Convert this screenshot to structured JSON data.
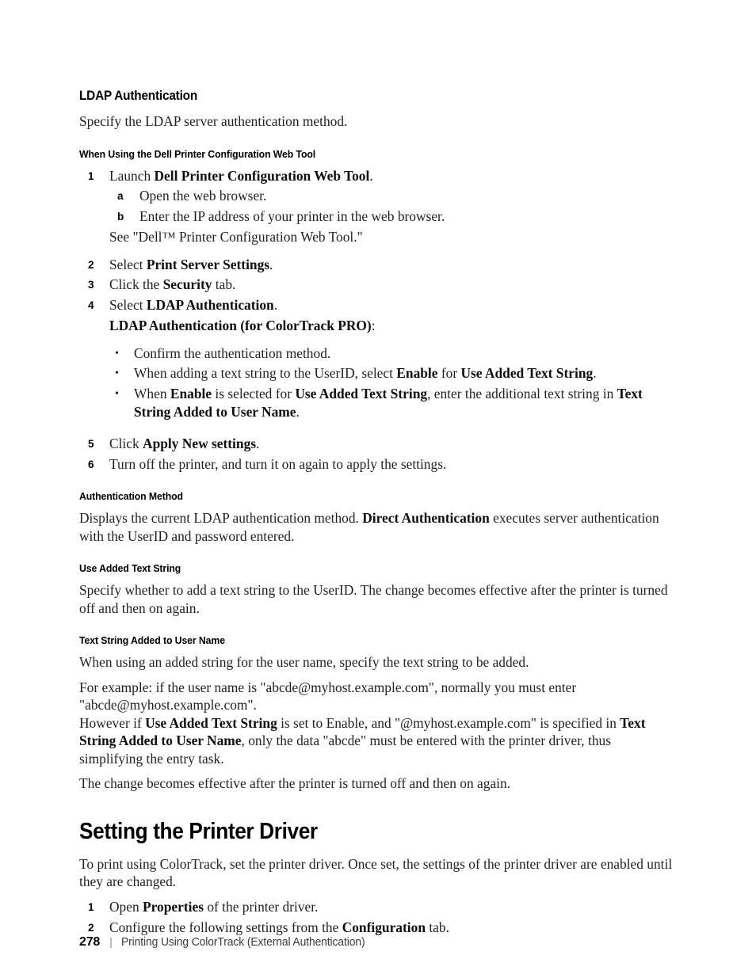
{
  "section": {
    "heading": "LDAP Authentication",
    "intro": "Specify the LDAP server authentication method."
  },
  "web_tool": {
    "heading": "When Using the Dell Printer Configuration Web Tool",
    "step1": {
      "num": "1",
      "text_before": "Launch ",
      "bold": "Dell Printer Configuration Web Tool",
      "text_after": "."
    },
    "substeps": [
      {
        "alpha": "a",
        "text": "Open the web browser."
      },
      {
        "alpha": "b",
        "text": "Enter the IP address of your printer in the web browser."
      }
    ],
    "see_note": "See \"Dell™ Printer Configuration Web Tool.\"",
    "step2": {
      "num": "2",
      "text_before": "Select ",
      "bold": "Print Server Settings",
      "text_after": "."
    },
    "step3": {
      "num": "3",
      "text_before": "Click the ",
      "bold": "Security",
      "text_after": " tab."
    },
    "step4": {
      "num": "4",
      "text_before": "Select ",
      "bold": "LDAP Authentication",
      "text_after": "."
    },
    "step4_subtitle_bold": "LDAP Authentication (for ColorTrack PRO)",
    "step4_subtitle_after": ":",
    "bullets": [
      {
        "parts": [
          {
            "t": "Confirm the authentication method.",
            "b": false
          }
        ]
      },
      {
        "parts": [
          {
            "t": "When adding a text string to the UserID, select ",
            "b": false
          },
          {
            "t": "Enable",
            "b": true
          },
          {
            "t": " for ",
            "b": false
          },
          {
            "t": "Use Added Text String",
            "b": true
          },
          {
            "t": ".",
            "b": false
          }
        ]
      },
      {
        "parts": [
          {
            "t": "When ",
            "b": false
          },
          {
            "t": "Enable",
            "b": true
          },
          {
            "t": " is selected for ",
            "b": false
          },
          {
            "t": "Use Added Text String",
            "b": true
          },
          {
            "t": ", enter the additional text string in ",
            "b": false
          },
          {
            "t": "Text String Added to User Name",
            "b": true
          },
          {
            "t": ".",
            "b": false
          }
        ]
      }
    ],
    "step5": {
      "num": "5",
      "text_before": "Click ",
      "bold": "Apply New settings",
      "text_after": "."
    },
    "step6": {
      "num": "6",
      "text_before": "Turn off the printer, and turn it on again to apply the settings.",
      "bold": "",
      "text_after": ""
    }
  },
  "auth_method": {
    "heading": "Authentication Method",
    "parts": [
      {
        "t": "Displays the current LDAP authentication method. ",
        "b": false
      },
      {
        "t": "Direct Authentication",
        "b": true
      },
      {
        "t": " executes server authentication with the UserID and password entered.",
        "b": false
      }
    ]
  },
  "use_added_text_string": {
    "heading": "Use Added Text String",
    "body": "Specify whether to add a text string to the UserID. The change becomes effective after the printer is turned off and then on again."
  },
  "text_string_added": {
    "heading": "Text String Added to User Name",
    "para1": "When using an added string for the user name, specify the text string to be added.",
    "para2": "For example: if the user name is \"abcde@myhost.example.com\", normally you must enter \"abcde@myhost.example.com\".",
    "para3_parts": [
      {
        "t": "However if ",
        "b": false
      },
      {
        "t": "Use Added Text String",
        "b": true
      },
      {
        "t": " is set to Enable, and \"@myhost.example.com\" is specified in ",
        "b": false
      },
      {
        "t": "Text String Added to User Name",
        "b": true
      },
      {
        "t": ", only the data \"abcde\" must be entered with the printer driver, thus simplifying the entry task.",
        "b": false
      }
    ],
    "para4": "The change becomes effective after the printer is turned off and then on again."
  },
  "printer_driver": {
    "heading": "Setting the Printer Driver",
    "intro": "To print using ColorTrack, set the printer driver. Once set, the settings of the printer driver are enabled until they are changed.",
    "steps": [
      {
        "num": "1",
        "parts": [
          {
            "t": "Open ",
            "b": false
          },
          {
            "t": "Properties",
            "b": true
          },
          {
            "t": " of the printer driver.",
            "b": false
          }
        ]
      },
      {
        "num": "2",
        "parts": [
          {
            "t": "Configure the following settings from the ",
            "b": false
          },
          {
            "t": "Configuration",
            "b": true
          },
          {
            "t": " tab.",
            "b": false
          }
        ]
      }
    ]
  },
  "footer": {
    "page_number": "278",
    "separator": "|",
    "chapter": "Printing Using ColorTrack (External Authentication)"
  },
  "icons": {
    "bullet": "•"
  }
}
